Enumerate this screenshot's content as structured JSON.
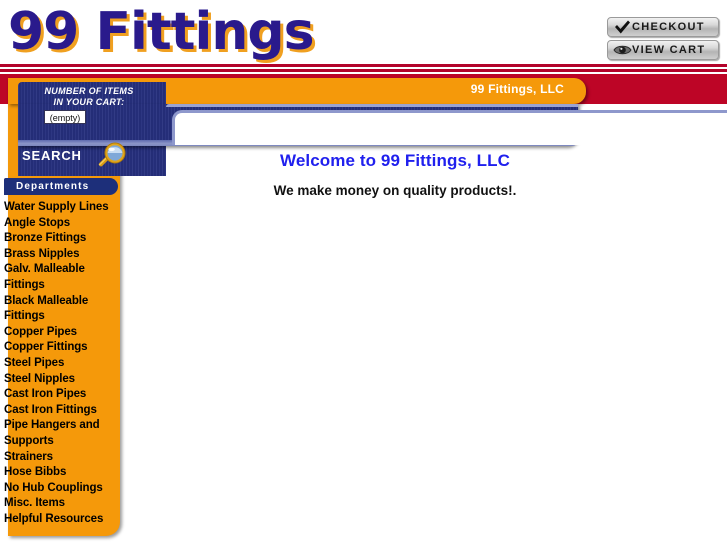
{
  "header": {
    "logo_text": "99 Fittings",
    "logo_color": "#2a1a8c",
    "logo_shadow_color": "#f0a020"
  },
  "top_buttons": [
    {
      "label": "CHECKOUT",
      "icon": "checkmark-icon"
    },
    {
      "label": "VIEW CART",
      "icon": "eye-icon"
    }
  ],
  "banner": {
    "company_name": "99 Fittings, LLC",
    "orange_color": "#f5990a",
    "red_color": "#bd0526",
    "blue_color": "#26307e"
  },
  "cart": {
    "label_line1": "NUMBER OF ITEMS",
    "label_line2": "IN YOUR CART:",
    "value": "(empty)"
  },
  "search": {
    "label": "SEARCH",
    "icon": "magnifying-glass-icon"
  },
  "departments": {
    "header": "Departments",
    "items": [
      {
        "label": "Water Supply Lines"
      },
      {
        "label": "Angle Stops"
      },
      {
        "label": "Bronze Fittings"
      },
      {
        "label": "Brass Nipples"
      },
      {
        "label": "Galv. Malleable Fittings"
      },
      {
        "label": "Black Malleable Fittings"
      },
      {
        "label": "Copper Pipes"
      },
      {
        "label": "Copper Fittings"
      },
      {
        "label": "Steel Pipes"
      },
      {
        "label": "Steel Nipples"
      },
      {
        "label": "Cast Iron Pipes"
      },
      {
        "label": "Cast Iron Fittings"
      },
      {
        "label": "Pipe Hangers and Supports"
      },
      {
        "label": "Strainers"
      },
      {
        "label": "Hose Bibbs"
      },
      {
        "label": "No Hub Couplings"
      },
      {
        "label": "Misc. Items"
      },
      {
        "label": "Helpful Resources"
      }
    ]
  },
  "main": {
    "title": "Welcome to 99 Fittings, LLC",
    "subtitle": "We make money on quality products!."
  }
}
